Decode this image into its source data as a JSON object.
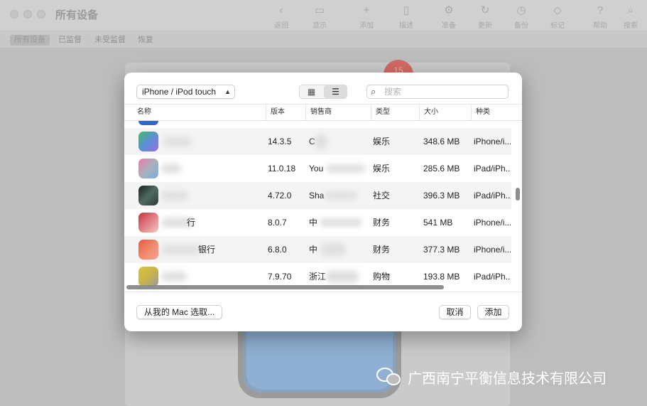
{
  "window": {
    "title": "所有设备",
    "toolbar": [
      {
        "icon": "chevron-left-icon",
        "glyph": "‹",
        "label": "返回"
      },
      {
        "icon": "display-icon",
        "glyph": "▭",
        "label": "显示"
      },
      {
        "icon": "plus-icon",
        "glyph": "+",
        "label": "添加"
      },
      {
        "icon": "profile-icon",
        "glyph": "▯",
        "label": "描述"
      },
      {
        "icon": "prepare-icon",
        "glyph": "⚙",
        "label": "准备"
      },
      {
        "icon": "update-icon",
        "glyph": "↻",
        "label": "更新"
      },
      {
        "icon": "backup-icon",
        "glyph": "◷",
        "label": "备份"
      },
      {
        "icon": "tag-icon",
        "glyph": "◇",
        "label": "标记"
      },
      {
        "icon": "help-icon",
        "glyph": "?",
        "label": "帮助"
      },
      {
        "icon": "search-icon",
        "glyph": "⌕",
        "label": "搜索"
      }
    ],
    "filters": [
      "所有设备",
      "已监督",
      "未受监督",
      "恢复"
    ],
    "badge": "15"
  },
  "dialog": {
    "device_filter": "iPhone / iPod touch",
    "search_placeholder": "搜索",
    "columns": [
      "名称",
      "版本",
      "销售商",
      "类型",
      "大小",
      "种类"
    ],
    "rows": [
      {
        "name": "",
        "version": "14.3.5",
        "vendor": "C",
        "type": "娱乐",
        "size": "348.6 MB",
        "kind": "iPhone/i...",
        "icon_color": "#5b8fd6"
      },
      {
        "name": "",
        "version": "11.0.18",
        "vendor": "You",
        "type": "娱乐",
        "size": "285.6 MB",
        "kind": "iPad/iPh...",
        "icon_color": "#a7b1bb"
      },
      {
        "name": "",
        "version": "4.72.0",
        "vendor": "Sha",
        "type": "社交",
        "size": "396.3 MB",
        "kind": "iPad/iPh...",
        "icon_color": "#2e3a36"
      },
      {
        "name": "行",
        "version": "8.0.7",
        "vendor": "中",
        "type": "财务",
        "size": "541 MB",
        "kind": "iPhone/i...",
        "icon_color": "#c4333b"
      },
      {
        "name": "银行",
        "version": "6.8.0",
        "vendor": "中",
        "type": "财务",
        "size": "377.3 MB",
        "kind": "iPhone/i...",
        "icon_color": "#e6583e"
      },
      {
        "name": "",
        "version": "7.9.70",
        "vendor": "浙江",
        "type": "购物",
        "size": "193.8 MB",
        "kind": "iPad/iPh...",
        "icon_color": "#d8c43a"
      }
    ],
    "choose_button": "从我的 Mac 选取...",
    "cancel_button": "取消",
    "add_button": "添加"
  },
  "watermark": "广西南宁平衡信息技术有限公司"
}
